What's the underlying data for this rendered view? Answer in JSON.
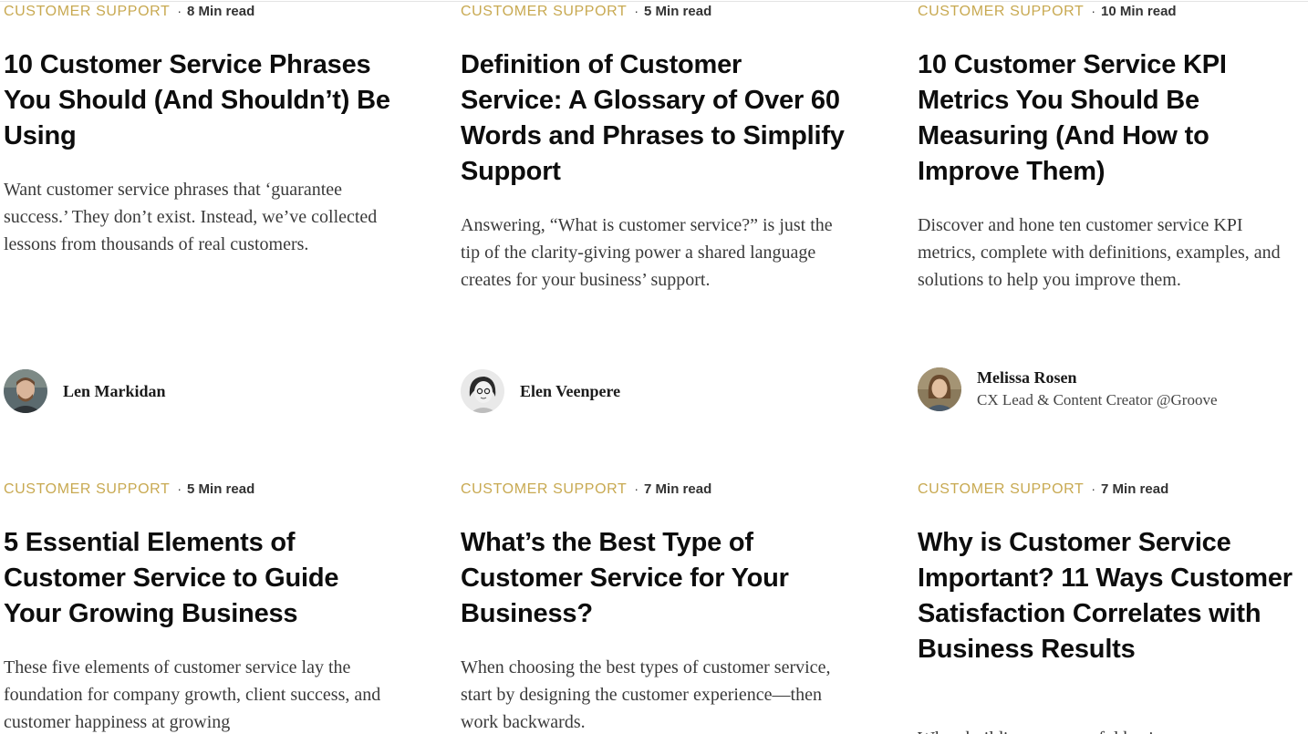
{
  "articles": [
    {
      "category": "CUSTOMER SUPPORT",
      "read_time": "8 Min read",
      "title": "10 Customer Service Phrases You Should (And Shouldn’t) Be Using",
      "excerpt": "Want customer service phrases that ‘guarantee success.’ They don’t exist. Instead, we’ve collected lessons from thousands of real customers.",
      "author": {
        "name": "Len Markidan",
        "role": ""
      }
    },
    {
      "category": "CUSTOMER SUPPORT",
      "read_time": "5 Min read",
      "title": "Definition of Customer Service: A Glossary of Over 60 Words and Phrases to Simplify Support",
      "excerpt": "Answering, “What is customer service?” is just the tip of the clarity-giving power a shared language creates for your business’ support.",
      "author": {
        "name": "Elen Veenpere",
        "role": ""
      }
    },
    {
      "category": "CUSTOMER SUPPORT",
      "read_time": "10 Min read",
      "title": "10 Customer Service KPI Metrics You Should Be Measuring (And How to Improve Them)",
      "excerpt": "Discover and hone ten customer service KPI metrics, complete with definitions, examples, and solutions to help you improve them.",
      "author": {
        "name": "Melissa Rosen",
        "role": "CX Lead & Content Creator @Groove"
      }
    },
    {
      "category": "CUSTOMER SUPPORT",
      "read_time": "5 Min read",
      "title": "5 Essential Elements of Customer Service to Guide Your Growing Business",
      "excerpt": "These five elements of customer service lay the foundation for company growth, client success, and customer happiness at growing"
    },
    {
      "category": "CUSTOMER SUPPORT",
      "read_time": "7 Min read",
      "title": "What’s the Best Type of Customer Service for Your Business?",
      "excerpt": "When choosing the best types of customer service, start by designing the customer experience—then work backwards."
    },
    {
      "category": "CUSTOMER SUPPORT",
      "read_time": "7 Min read",
      "title": "Why is Customer Service Important? 11 Ways Customer Satisfaction Correlates with Business Results",
      "excerpt": "When building a successful busi"
    }
  ],
  "colors": {
    "category": "#c8a951",
    "title": "#0d0d0d",
    "body": "#3a3a3a"
  }
}
